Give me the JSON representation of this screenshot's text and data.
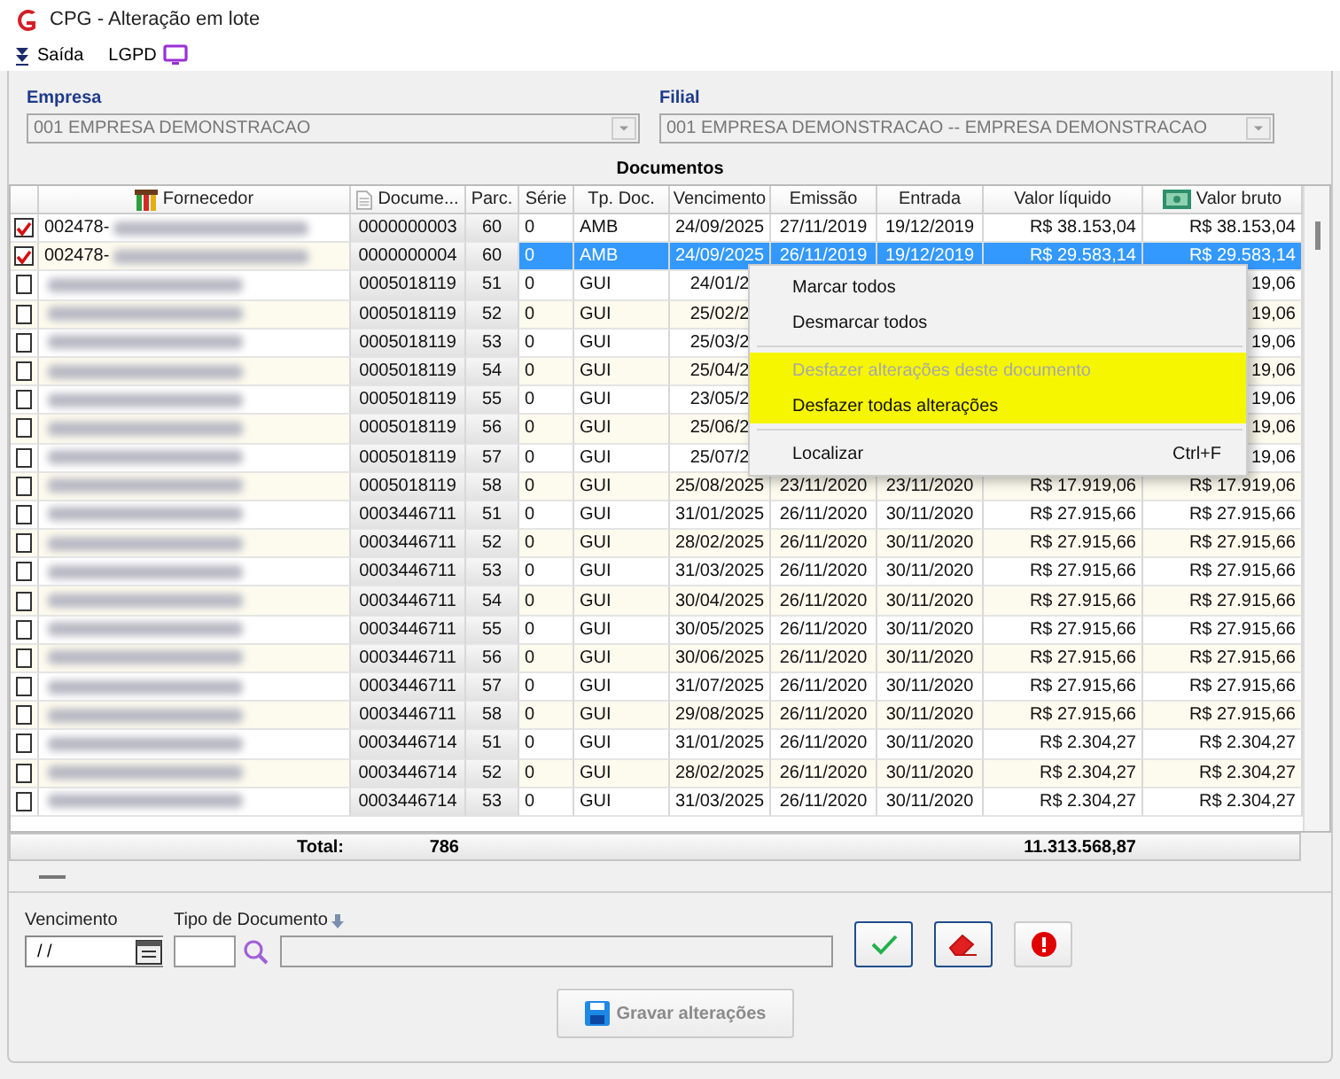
{
  "window": {
    "title": "CPG - Alteração em lote"
  },
  "toolbar": [
    {
      "kind": "exit",
      "label": "Saída"
    },
    {
      "kind": "lgpd",
      "label": "LGPD"
    }
  ],
  "filters": [
    {
      "label": "Empresa",
      "value": "001 EMPRESA DEMONSTRACAO",
      "disabled": true
    },
    {
      "label": "Filial",
      "value": "001 EMPRESA DEMONSTRACAO -- EMPRESA DEMONSTRACAO",
      "disabled": true
    }
  ],
  "table": {
    "title": "Documentos",
    "columns": [
      "Fornecedor",
      "Docume...",
      "Parc.",
      "Série",
      "Tp. Doc.",
      "Vencimento",
      "Emissão",
      "Entrada",
      "Valor líquido",
      "Valor bruto"
    ],
    "rows": [
      {
        "checked": true,
        "selected": false,
        "supplier": "002478-",
        "document": "0000000003",
        "installment": "60",
        "series": "0",
        "doc_type": "AMB",
        "due": "24/09/2025",
        "issued": "27/11/2019",
        "entry": "19/12/2019",
        "net": "R$ 38.153,04",
        "gross": "R$ 38.153,04"
      },
      {
        "checked": true,
        "selected": true,
        "supplier": "002478-",
        "document": "0000000004",
        "installment": "60",
        "series": "0",
        "doc_type": "AMB",
        "due": "24/09/2025",
        "issued": "26/11/2019",
        "entry": "19/12/2019",
        "net": "R$ 29.583,14",
        "gross": "R$ 29.583,14"
      },
      {
        "checked": false,
        "selected": false,
        "document": "0005018119",
        "installment": "51",
        "series": "0",
        "doc_type": "GUI",
        "due": "24/01/2",
        "gross": "19,06"
      },
      {
        "checked": false,
        "selected": false,
        "document": "0005018119",
        "installment": "52",
        "series": "0",
        "doc_type": "GUI",
        "due": "25/02/2",
        "gross": "19,06"
      },
      {
        "checked": false,
        "selected": false,
        "document": "0005018119",
        "installment": "53",
        "series": "0",
        "doc_type": "GUI",
        "due": "25/03/2",
        "gross": "19,06"
      },
      {
        "checked": false,
        "selected": false,
        "document": "0005018119",
        "installment": "54",
        "series": "0",
        "doc_type": "GUI",
        "due": "25/04/2",
        "gross": "19,06"
      },
      {
        "checked": false,
        "selected": false,
        "document": "0005018119",
        "installment": "55",
        "series": "0",
        "doc_type": "GUI",
        "due": "23/05/2",
        "gross": "19,06"
      },
      {
        "checked": false,
        "selected": false,
        "document": "0005018119",
        "installment": "56",
        "series": "0",
        "doc_type": "GUI",
        "due": "25/06/2",
        "gross": "19,06"
      },
      {
        "checked": false,
        "selected": false,
        "document": "0005018119",
        "installment": "57",
        "series": "0",
        "doc_type": "GUI",
        "due": "25/07/2",
        "gross": "19,06"
      },
      {
        "checked": false,
        "selected": false,
        "document": "0005018119",
        "installment": "58",
        "series": "0",
        "doc_type": "GUI",
        "due": "25/08/2025",
        "issued": "23/11/2020",
        "entry": "23/11/2020",
        "net": "R$ 17.919,06",
        "gross": "R$ 17.919,06"
      },
      {
        "checked": false,
        "selected": false,
        "document": "0003446711",
        "installment": "51",
        "series": "0",
        "doc_type": "GUI",
        "due": "31/01/2025",
        "issued": "26/11/2020",
        "entry": "30/11/2020",
        "net": "R$ 27.915,66",
        "gross": "R$ 27.915,66"
      },
      {
        "checked": false,
        "selected": false,
        "document": "0003446711",
        "installment": "52",
        "series": "0",
        "doc_type": "GUI",
        "due": "28/02/2025",
        "issued": "26/11/2020",
        "entry": "30/11/2020",
        "net": "R$ 27.915,66",
        "gross": "R$ 27.915,66"
      },
      {
        "checked": false,
        "selected": false,
        "document": "0003446711",
        "installment": "53",
        "series": "0",
        "doc_type": "GUI",
        "due": "31/03/2025",
        "issued": "26/11/2020",
        "entry": "30/11/2020",
        "net": "R$ 27.915,66",
        "gross": "R$ 27.915,66"
      },
      {
        "checked": false,
        "selected": false,
        "document": "0003446711",
        "installment": "54",
        "series": "0",
        "doc_type": "GUI",
        "due": "30/04/2025",
        "issued": "26/11/2020",
        "entry": "30/11/2020",
        "net": "R$ 27.915,66",
        "gross": "R$ 27.915,66"
      },
      {
        "checked": false,
        "selected": false,
        "document": "0003446711",
        "installment": "55",
        "series": "0",
        "doc_type": "GUI",
        "due": "30/05/2025",
        "issued": "26/11/2020",
        "entry": "30/11/2020",
        "net": "R$ 27.915,66",
        "gross": "R$ 27.915,66"
      },
      {
        "checked": false,
        "selected": false,
        "document": "0003446711",
        "installment": "56",
        "series": "0",
        "doc_type": "GUI",
        "due": "30/06/2025",
        "issued": "26/11/2020",
        "entry": "30/11/2020",
        "net": "R$ 27.915,66",
        "gross": "R$ 27.915,66"
      },
      {
        "checked": false,
        "selected": false,
        "document": "0003446711",
        "installment": "57",
        "series": "0",
        "doc_type": "GUI",
        "due": "31/07/2025",
        "issued": "26/11/2020",
        "entry": "30/11/2020",
        "net": "R$ 27.915,66",
        "gross": "R$ 27.915,66"
      },
      {
        "checked": false,
        "selected": false,
        "document": "0003446711",
        "installment": "58",
        "series": "0",
        "doc_type": "GUI",
        "due": "29/08/2025",
        "issued": "26/11/2020",
        "entry": "30/11/2020",
        "net": "R$ 27.915,66",
        "gross": "R$ 27.915,66"
      },
      {
        "checked": false,
        "selected": false,
        "document": "0003446714",
        "installment": "51",
        "series": "0",
        "doc_type": "GUI",
        "due": "31/01/2025",
        "issued": "26/11/2020",
        "entry": "30/11/2020",
        "net": "R$ 2.304,27",
        "gross": "R$ 2.304,27"
      },
      {
        "checked": false,
        "selected": false,
        "document": "0003446714",
        "installment": "52",
        "series": "0",
        "doc_type": "GUI",
        "due": "28/02/2025",
        "issued": "26/11/2020",
        "entry": "30/11/2020",
        "net": "R$ 2.304,27",
        "gross": "R$ 2.304,27"
      },
      {
        "checked": false,
        "selected": false,
        "document": "0003446714",
        "installment": "53",
        "series": "0",
        "doc_type": "GUI",
        "due": "31/03/2025",
        "issued": "26/11/2020",
        "entry": "30/11/2020",
        "net": "R$ 2.304,27",
        "gross": "R$ 2.304,27"
      }
    ],
    "total": {
      "label": "Total:",
      "count": "786",
      "amount": "11.313.568,87"
    }
  },
  "context_menu": [
    {
      "kind": "item",
      "label": "Marcar todos",
      "disabled": false,
      "highlighted": false
    },
    {
      "kind": "item",
      "label": "Desmarcar todos",
      "disabled": false,
      "highlighted": false
    },
    {
      "kind": "separator"
    },
    {
      "kind": "item",
      "label": "Desfazer alterações deste documento",
      "disabled": true,
      "highlighted": true
    },
    {
      "kind": "item",
      "label": "Desfazer todas alterações",
      "disabled": false,
      "highlighted": true
    },
    {
      "kind": "separator"
    },
    {
      "kind": "item",
      "label": "Localizar",
      "shortcut": "Ctrl+F",
      "disabled": false,
      "highlighted": false
    }
  ],
  "editor": {
    "due_label": "Vencimento",
    "due_value": "/ /",
    "doc_type_label": "Tipo de Documento"
  },
  "actions": [
    {
      "kind": "confirm"
    },
    {
      "kind": "clear"
    },
    {
      "kind": "error"
    }
  ],
  "save_button": {
    "label": "Gravar alterações",
    "disabled": true
  }
}
